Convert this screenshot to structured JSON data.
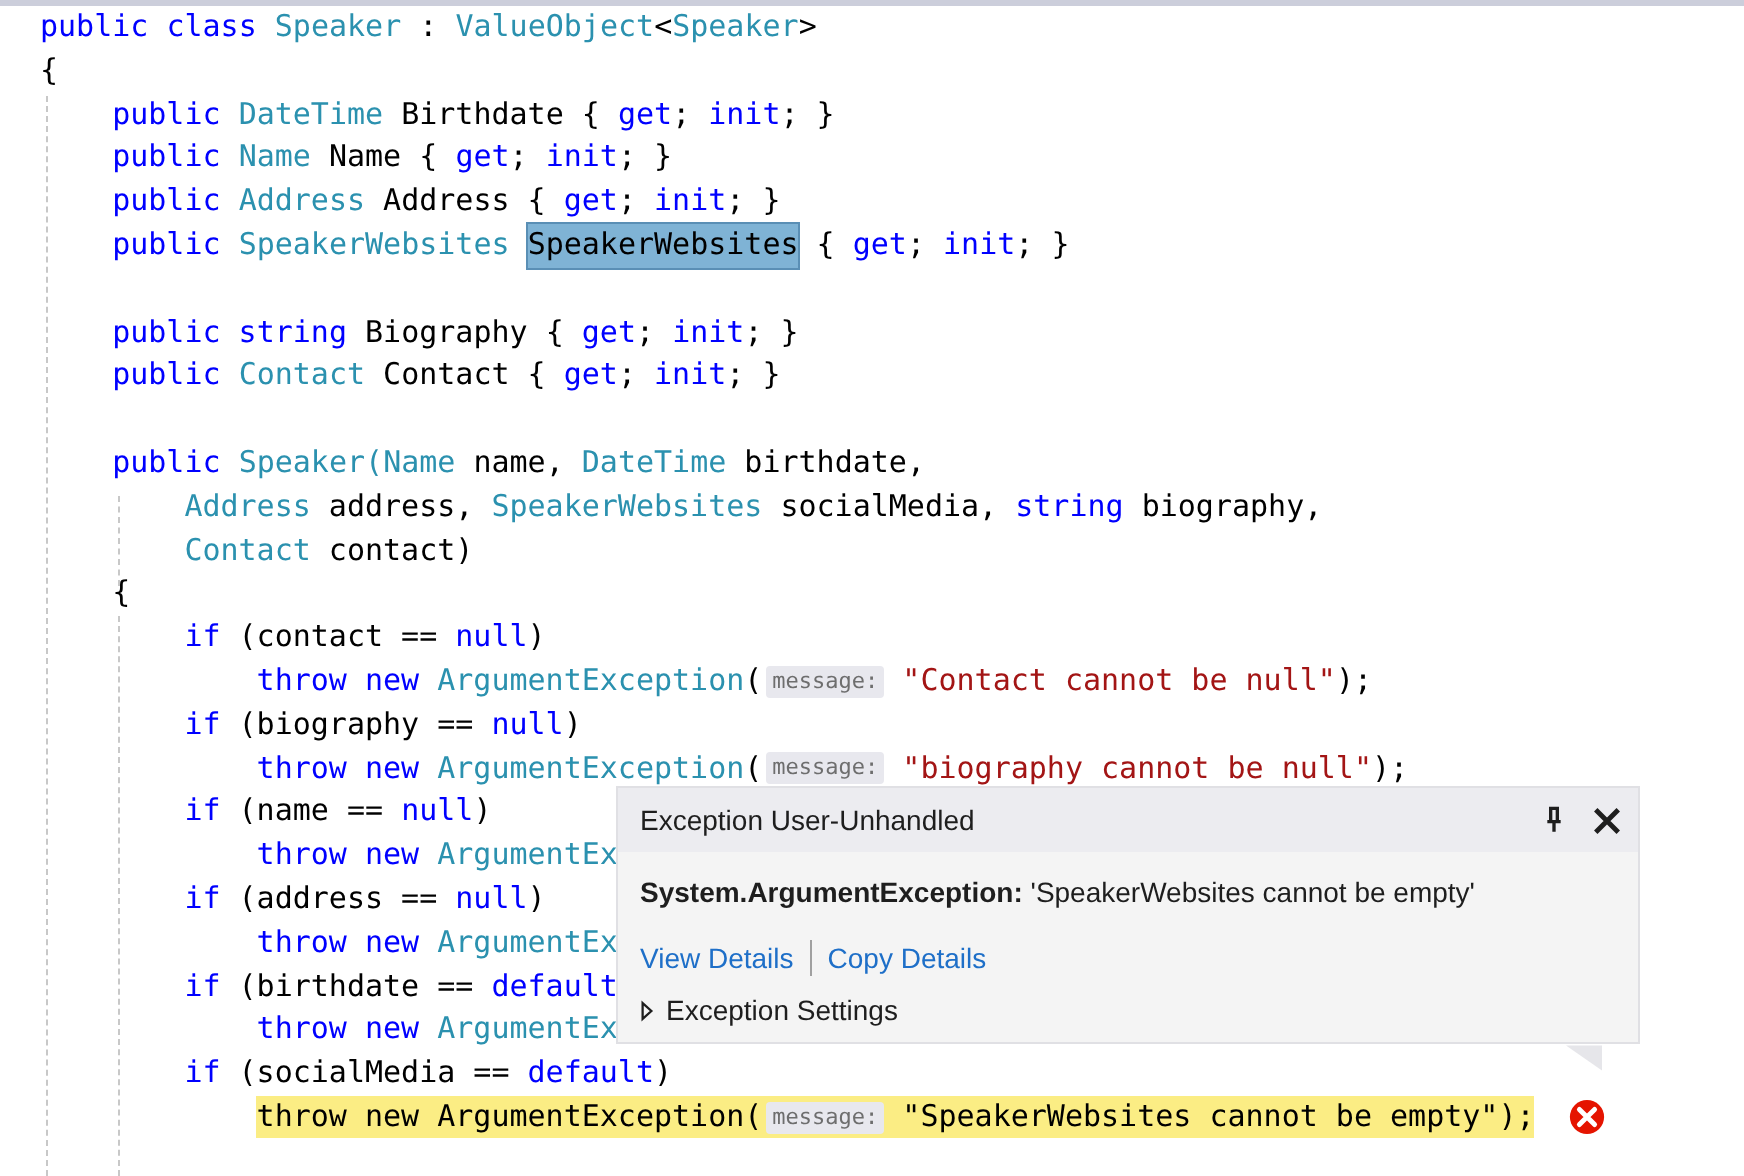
{
  "editor": {
    "lines": [
      {
        "kind": "code",
        "highlighted": false,
        "tokens": [
          {
            "kind": "keyword",
            "text": "public class "
          },
          {
            "kind": "type",
            "text": "Speaker"
          },
          {
            "kind": "plain",
            "text": " : "
          },
          {
            "kind": "type",
            "text": "ValueObject"
          },
          {
            "kind": "plain",
            "text": "<"
          },
          {
            "kind": "type",
            "text": "Speaker"
          },
          {
            "kind": "plain",
            "text": ">"
          }
        ]
      },
      {
        "kind": "code",
        "highlighted": false,
        "tokens": [
          {
            "kind": "plain",
            "text": "{"
          }
        ],
        "children": [
          {
            "kind": "code",
            "highlighted": false,
            "tokens": [
              {
                "kind": "keyword",
                "text": "public "
              },
              {
                "kind": "type",
                "text": "DateTime"
              },
              {
                "kind": "plain",
                "text": " Birthdate { "
              },
              {
                "kind": "keyword",
                "text": "get"
              },
              {
                "kind": "plain",
                "text": "; "
              },
              {
                "kind": "keyword",
                "text": "init"
              },
              {
                "kind": "plain",
                "text": "; }"
              }
            ]
          },
          {
            "kind": "code",
            "highlighted": false,
            "tokens": [
              {
                "kind": "keyword",
                "text": "public "
              },
              {
                "kind": "type",
                "text": "Name"
              },
              {
                "kind": "plain",
                "text": " Name { "
              },
              {
                "kind": "keyword",
                "text": "get"
              },
              {
                "kind": "plain",
                "text": "; "
              },
              {
                "kind": "keyword",
                "text": "init"
              },
              {
                "kind": "plain",
                "text": "; }"
              }
            ]
          },
          {
            "kind": "code",
            "highlighted": false,
            "tokens": [
              {
                "kind": "keyword",
                "text": "public "
              },
              {
                "kind": "type",
                "text": "Address"
              },
              {
                "kind": "plain",
                "text": " Address { "
              },
              {
                "kind": "keyword",
                "text": "get"
              },
              {
                "kind": "plain",
                "text": "; "
              },
              {
                "kind": "keyword",
                "text": "init"
              },
              {
                "kind": "plain",
                "text": "; }"
              }
            ]
          },
          {
            "kind": "code",
            "highlighted": false,
            "tokens": [
              {
                "kind": "keyword",
                "text": "public "
              },
              {
                "kind": "type",
                "text": "SpeakerWebsites "
              },
              {
                "kind": "selection",
                "text": "SpeakerWebsites"
              },
              {
                "kind": "plain",
                "text": " { "
              },
              {
                "kind": "keyword",
                "text": "get"
              },
              {
                "kind": "plain",
                "text": "; "
              },
              {
                "kind": "keyword",
                "text": "init"
              },
              {
                "kind": "plain",
                "text": "; }"
              }
            ]
          },
          {
            "kind": "blank"
          },
          {
            "kind": "code",
            "highlighted": false,
            "tokens": [
              {
                "kind": "keyword",
                "text": "public string"
              },
              {
                "kind": "plain",
                "text": " Biography { "
              },
              {
                "kind": "keyword",
                "text": "get"
              },
              {
                "kind": "plain",
                "text": "; "
              },
              {
                "kind": "keyword",
                "text": "init"
              },
              {
                "kind": "plain",
                "text": "; }"
              }
            ]
          },
          {
            "kind": "code",
            "highlighted": false,
            "tokens": [
              {
                "kind": "keyword",
                "text": "public "
              },
              {
                "kind": "type",
                "text": "Contact"
              },
              {
                "kind": "plain",
                "text": " Contact { "
              },
              {
                "kind": "keyword",
                "text": "get"
              },
              {
                "kind": "plain",
                "text": "; "
              },
              {
                "kind": "keyword",
                "text": "init"
              },
              {
                "kind": "plain",
                "text": "; }"
              }
            ]
          },
          {
            "kind": "blank"
          },
          {
            "kind": "code",
            "highlighted": false,
            "tokens": [
              {
                "kind": "keyword",
                "text": "public "
              },
              {
                "kind": "type",
                "text": "Speaker("
              },
              {
                "kind": "type",
                "text": "Name"
              },
              {
                "kind": "plain",
                "text": " name, "
              },
              {
                "kind": "type",
                "text": "DateTime"
              },
              {
                "kind": "plain",
                "text": " birthdate,"
              }
            ],
            "children": [
              {
                "kind": "code",
                "highlighted": false,
                "tokens": [
                  {
                    "kind": "type",
                    "text": "Address"
                  },
                  {
                    "kind": "plain",
                    "text": " address, "
                  },
                  {
                    "kind": "type",
                    "text": "SpeakerWebsites"
                  },
                  {
                    "kind": "plain",
                    "text": " socialMedia, "
                  },
                  {
                    "kind": "keyword",
                    "text": "string"
                  },
                  {
                    "kind": "plain",
                    "text": " biography,"
                  }
                ]
              },
              {
                "kind": "code",
                "highlighted": false,
                "tokens": [
                  {
                    "kind": "type",
                    "text": "Contact"
                  },
                  {
                    "kind": "plain",
                    "text": " contact)"
                  }
                ]
              }
            ]
          },
          {
            "kind": "code",
            "highlighted": false,
            "tokens": [
              {
                "kind": "plain",
                "text": "{"
              }
            ],
            "children": [
              {
                "kind": "code",
                "highlighted": false,
                "tokens": [
                  {
                    "kind": "keyword",
                    "text": "if"
                  },
                  {
                    "kind": "plain",
                    "text": " (contact == "
                  },
                  {
                    "kind": "keyword",
                    "text": "null"
                  },
                  {
                    "kind": "plain",
                    "text": ")"
                  }
                ],
                "children": [
                  {
                    "kind": "code",
                    "highlighted": false,
                    "tokens": [
                      {
                        "kind": "keyword",
                        "text": "throw new "
                      },
                      {
                        "kind": "type",
                        "text": "ArgumentException"
                      },
                      {
                        "kind": "plain",
                        "text": "("
                      },
                      {
                        "kind": "hint",
                        "text": "message:"
                      },
                      {
                        "kind": "string",
                        "text": " \"Contact cannot be null\""
                      },
                      {
                        "kind": "plain",
                        "text": ");"
                      }
                    ]
                  }
                ]
              },
              {
                "kind": "code",
                "highlighted": false,
                "tokens": [
                  {
                    "kind": "keyword",
                    "text": "if"
                  },
                  {
                    "kind": "plain",
                    "text": " (biography == "
                  },
                  {
                    "kind": "keyword",
                    "text": "null"
                  },
                  {
                    "kind": "plain",
                    "text": ")"
                  }
                ],
                "children": [
                  {
                    "kind": "code",
                    "highlighted": false,
                    "tokens": [
                      {
                        "kind": "keyword",
                        "text": "throw new "
                      },
                      {
                        "kind": "type",
                        "text": "ArgumentException"
                      },
                      {
                        "kind": "plain",
                        "text": "("
                      },
                      {
                        "kind": "hint",
                        "text": "message:"
                      },
                      {
                        "kind": "string",
                        "text": " \"biography cannot be null\""
                      },
                      {
                        "kind": "plain",
                        "text": ");"
                      }
                    ]
                  }
                ]
              },
              {
                "kind": "code",
                "highlighted": false,
                "tokens": [
                  {
                    "kind": "keyword",
                    "text": "if"
                  },
                  {
                    "kind": "plain",
                    "text": " (name == "
                  },
                  {
                    "kind": "keyword",
                    "text": "null"
                  },
                  {
                    "kind": "plain",
                    "text": ")"
                  }
                ],
                "children": [
                  {
                    "kind": "code",
                    "highlighted": false,
                    "tokens": [
                      {
                        "kind": "keyword",
                        "text": "throw new "
                      },
                      {
                        "kind": "type",
                        "text": "ArgumentEx"
                      }
                    ]
                  }
                ]
              },
              {
                "kind": "code",
                "highlighted": false,
                "tokens": [
                  {
                    "kind": "keyword",
                    "text": "if"
                  },
                  {
                    "kind": "plain",
                    "text": " (address == "
                  },
                  {
                    "kind": "keyword",
                    "text": "null"
                  },
                  {
                    "kind": "plain",
                    "text": ")"
                  }
                ],
                "children": [
                  {
                    "kind": "code",
                    "highlighted": false,
                    "tokens": [
                      {
                        "kind": "keyword",
                        "text": "throw new "
                      },
                      {
                        "kind": "type",
                        "text": "ArgumentEx"
                      }
                    ]
                  }
                ]
              },
              {
                "kind": "code",
                "highlighted": false,
                "tokens": [
                  {
                    "kind": "keyword",
                    "text": "if"
                  },
                  {
                    "kind": "plain",
                    "text": " (birthdate == "
                  },
                  {
                    "kind": "keyword",
                    "text": "default"
                  }
                ],
                "children": [
                  {
                    "kind": "code",
                    "highlighted": false,
                    "tokens": [
                      {
                        "kind": "keyword",
                        "text": "throw new "
                      },
                      {
                        "kind": "type",
                        "text": "ArgumentEx"
                      }
                    ]
                  }
                ]
              },
              {
                "kind": "code",
                "highlighted": false,
                "tokens": [
                  {
                    "kind": "keyword",
                    "text": "if"
                  },
                  {
                    "kind": "plain",
                    "text": " (socialMedia == "
                  },
                  {
                    "kind": "keyword",
                    "text": "default"
                  },
                  {
                    "kind": "plain",
                    "text": ")"
                  }
                ],
                "children": [
                  {
                    "kind": "code",
                    "highlighted": true,
                    "tokens": [
                      {
                        "kind": "plain",
                        "text": "throw new ArgumentException("
                      },
                      {
                        "kind": "hint",
                        "text": "message:"
                      },
                      {
                        "kind": "plain",
                        "text": " \"SpeakerWebsites cannot be empty\");"
                      }
                    ]
                  }
                ]
              }
            ]
          }
        ]
      }
    ]
  },
  "exception_popup": {
    "title": "Exception User-Unhandled",
    "message": "**System.ArgumentException:** 'SpeakerWebsites cannot be empty'",
    "links": [
      "View Details",
      "Copy Details"
    ],
    "settings": {
      "label": "Exception Settings",
      "expanded": false
    }
  }
}
